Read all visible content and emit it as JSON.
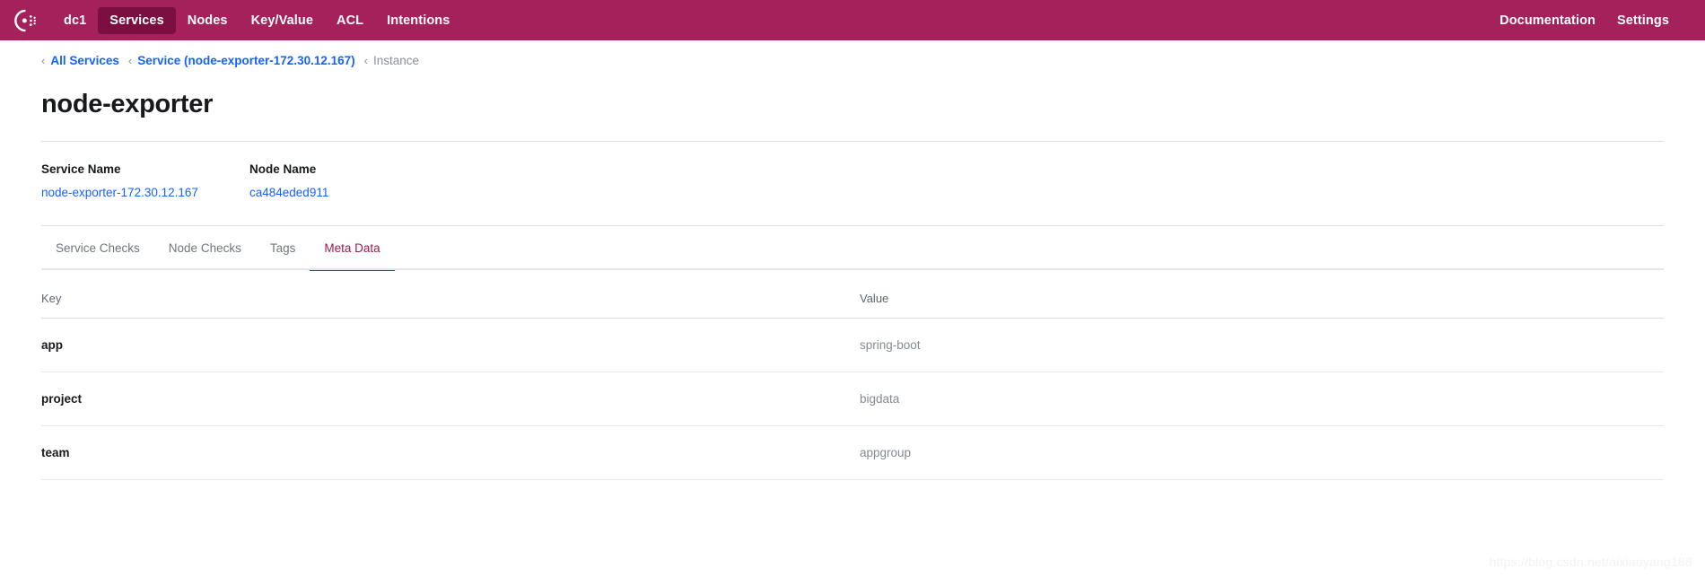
{
  "navbar": {
    "logo_icon": "consul-logo-icon",
    "background_color": "#a5215b",
    "active_background_color": "#7b0f41",
    "left_items": [
      {
        "label": "dc1",
        "active": false
      },
      {
        "label": "Services",
        "active": true
      },
      {
        "label": "Nodes",
        "active": false
      },
      {
        "label": "Key/Value",
        "active": false
      },
      {
        "label": "ACL",
        "active": false
      },
      {
        "label": "Intentions",
        "active": false
      }
    ],
    "right_items": [
      {
        "label": "Documentation"
      },
      {
        "label": "Settings"
      }
    ]
  },
  "breadcrumb": {
    "chevron": "‹",
    "items": [
      {
        "label": "All Services",
        "current": false
      },
      {
        "label": "Service (node-exporter-172.30.12.167)",
        "current": false
      },
      {
        "label": "Instance",
        "current": true
      }
    ]
  },
  "page": {
    "title": "node-exporter"
  },
  "details": [
    {
      "label": "Service Name",
      "value": "node-exporter-172.30.12.167"
    },
    {
      "label": "Node Name",
      "value": "ca484eded911"
    }
  ],
  "tabs": [
    {
      "label": "Service Checks",
      "active": false
    },
    {
      "label": "Node Checks",
      "active": false
    },
    {
      "label": "Tags",
      "active": false
    },
    {
      "label": "Meta Data",
      "active": true
    }
  ],
  "table": {
    "columns": [
      "Key",
      "Value"
    ],
    "rows": [
      {
        "key": "app",
        "value": "spring-boot"
      },
      {
        "key": "project",
        "value": "bigdata"
      },
      {
        "key": "team",
        "value": "appgroup"
      }
    ]
  },
  "watermark": {
    "text": "https://blog.csdn.net/aixiaoyang168"
  },
  "colors": {
    "brand": "#a5215b",
    "brand_dark": "#7b0f41",
    "link": "#1563ff",
    "accent": "#9c1c4d",
    "muted": "#8a9099"
  }
}
